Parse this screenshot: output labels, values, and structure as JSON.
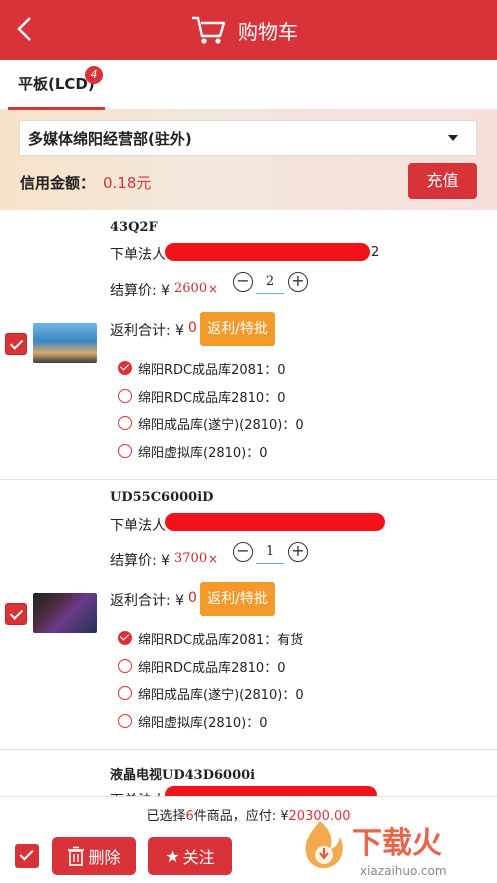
{
  "header": {
    "title": "购物车"
  },
  "tabs": [
    {
      "label": "平板(LCD)",
      "badge": "4"
    }
  ],
  "account": {
    "org": "多媒体绵阳经营部(驻外)",
    "credit_label": "信用金额：",
    "credit_value": "0.18元",
    "recharge_label": "充值"
  },
  "items": [
    {
      "model": "43Q2F",
      "orderer_label": "下单法人",
      "orderer_tail": "2",
      "price_label": "结算价: ¥",
      "price": "2600",
      "times": "×",
      "qty": "2",
      "rebate_label": "返利合计: ¥",
      "rebate_value": "0",
      "rebate_btn": "返利/特批",
      "warehouses": [
        {
          "label": "绵阳RDC成品库2081：0",
          "selected": true
        },
        {
          "label": "绵阳RDC成品库2810：0",
          "selected": false
        },
        {
          "label": "绵阳成品库(遂宁)(2810)：0",
          "selected": false
        },
        {
          "label": "绵阳虚拟库(2810)：0",
          "selected": false
        }
      ]
    },
    {
      "model": "UD55C6000iD",
      "orderer_label": "下单法人",
      "price_label": "结算价: ¥",
      "price": "3700",
      "times": "×",
      "qty": "1",
      "rebate_label": "返利合计: ¥",
      "rebate_value": "0",
      "rebate_btn": "返利/特批",
      "warehouses": [
        {
          "label": "绵阳RDC成品库2081：有货",
          "selected": true
        },
        {
          "label": "绵阳RDC成品库2810：0",
          "selected": false
        },
        {
          "label": "绵阳成品库(遂宁)(2810)：0",
          "selected": false
        },
        {
          "label": "绵阳虚拟库(2810)：0",
          "selected": false
        }
      ]
    },
    {
      "model": "液晶电视UD43D6000i",
      "orderer_label": "下单法人"
    }
  ],
  "footer": {
    "summary_prefix": "已选择",
    "summary_count": "6",
    "summary_mid": "件商品，应付: ¥",
    "summary_total": "20300.00",
    "delete_label": "删除",
    "follow_label": "关注"
  },
  "watermark": {
    "text": "下载火",
    "url": "xiazaihuo.com"
  },
  "colors": {
    "accent": "#d9333a",
    "rebate_button": "#f39a2b",
    "redaction": "#f2131a"
  }
}
